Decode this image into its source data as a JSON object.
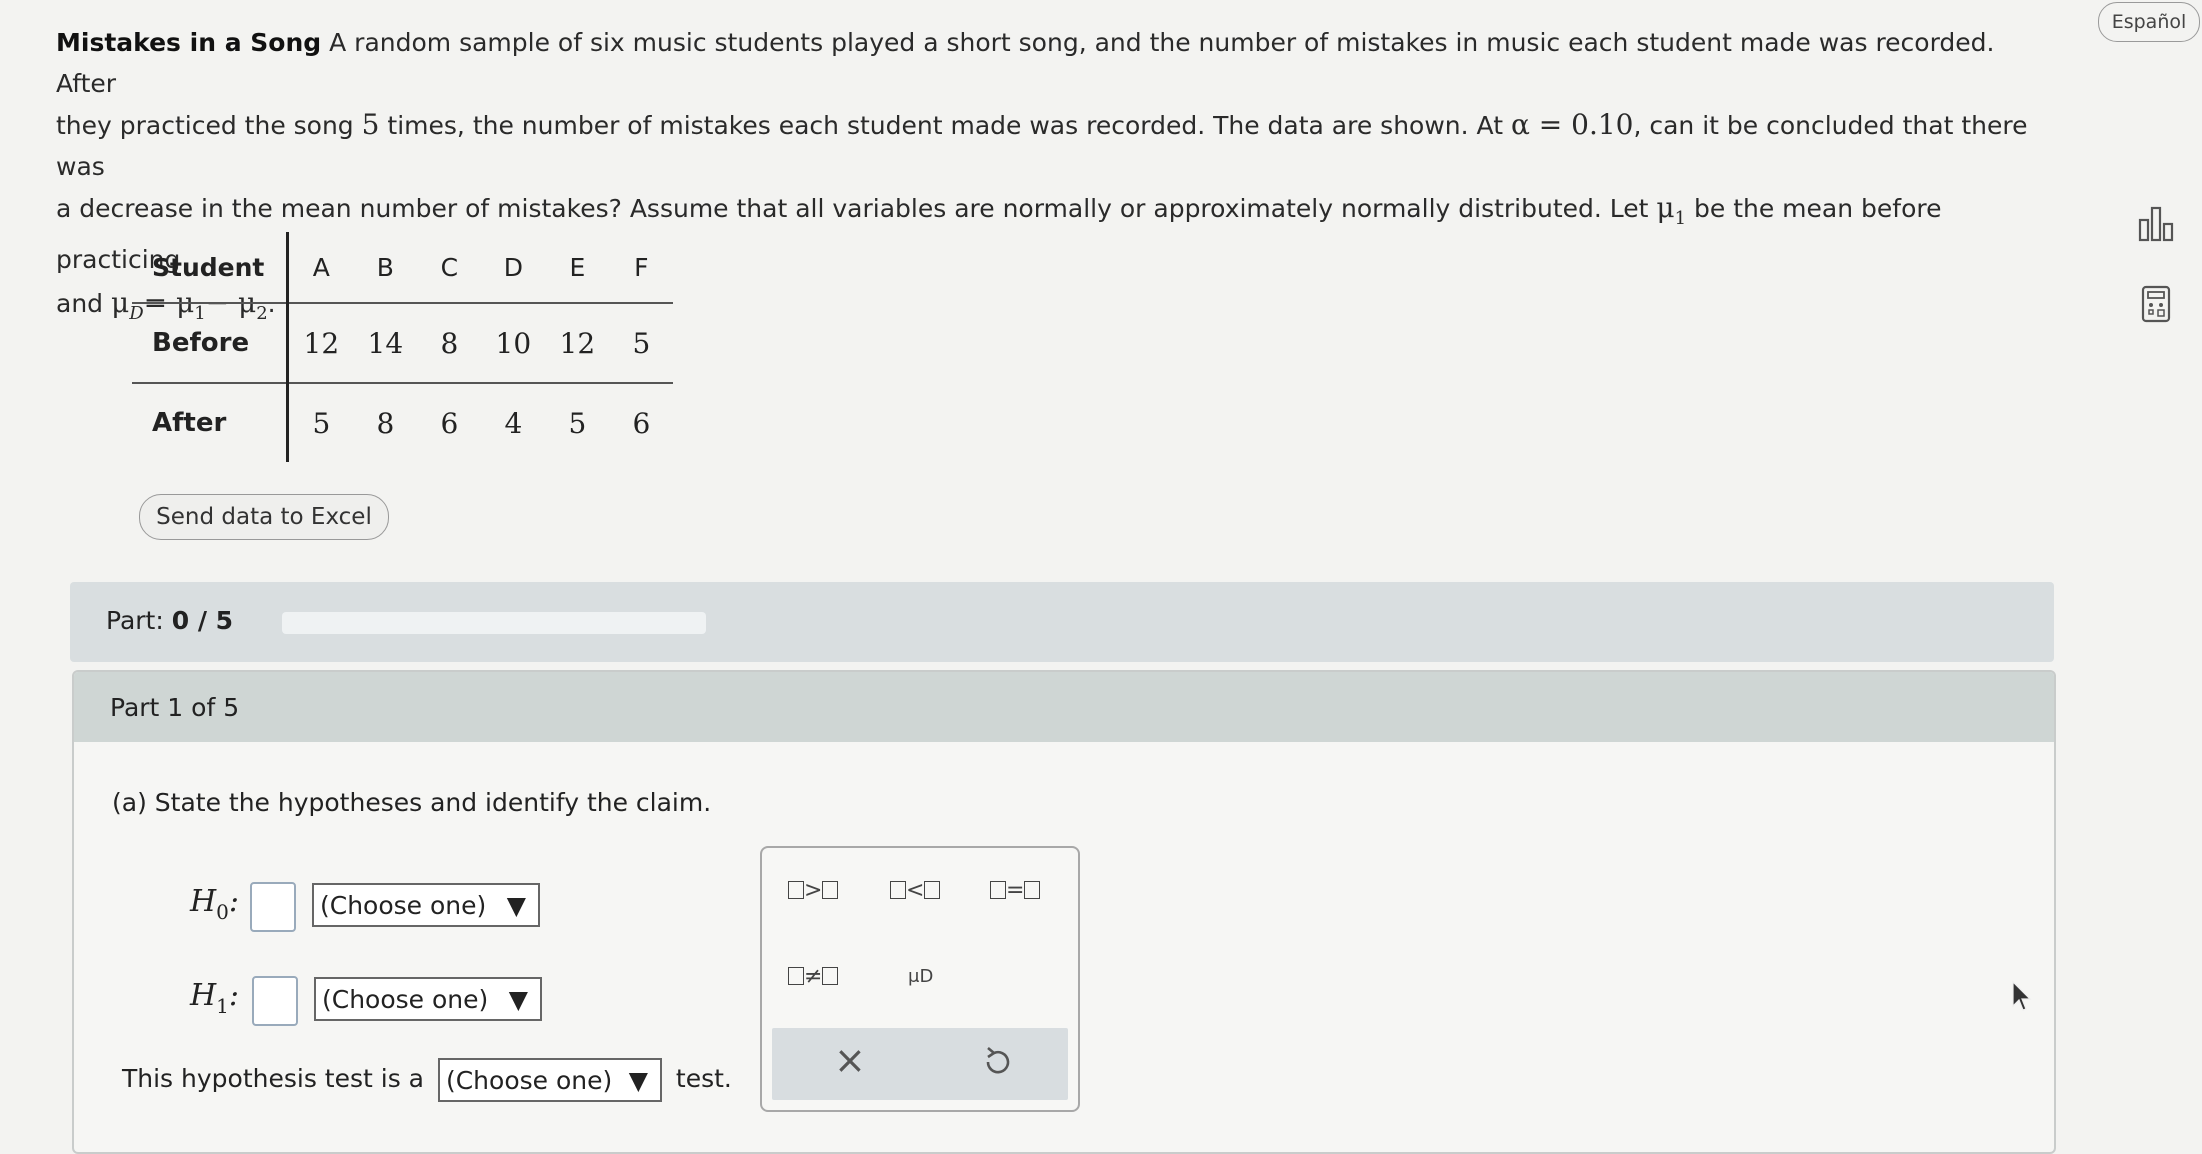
{
  "language_button": "Español",
  "problem": {
    "title": "Mistakes in a Song",
    "line1": " A random sample of six music students played a short song, and the number of mistakes in music each student made was recorded. After",
    "line2a": "they practiced the song ",
    "times": "5",
    "line2b": " times, the number of mistakes each student made was recorded. The data are shown. At ",
    "alpha": "α = 0.10",
    "line2c": ", can it be concluded that there was",
    "line3a": "a decrease in the mean number of mistakes? Assume that all variables are normally or approximately normally distributed. Let ",
    "mu1": "μ",
    "line3b": " be the mean before practicing",
    "line4a": "and ",
    "mud": "μ",
    "line4b": "= μ",
    "line4c": "− μ",
    "line4d": "."
  },
  "table": {
    "row_labels": [
      "Student",
      "Before",
      "After"
    ],
    "students": [
      "A",
      "B",
      "C",
      "D",
      "E",
      "F"
    ],
    "before": [
      "12",
      "14",
      "8",
      "10",
      "12",
      "5"
    ],
    "after": [
      "5",
      "8",
      "6",
      "4",
      "5",
      "6"
    ]
  },
  "excel_button": "Send data to Excel",
  "part_bar": {
    "label": "Part:",
    "progress_text": "0 / 5",
    "progress_fraction": 0
  },
  "panel": {
    "header": "Part 1 of 5",
    "question": "(a) State the hypotheses and identify the claim.",
    "h0_letter": "H",
    "h0_sub": "0",
    "h1_letter": "H",
    "h1_sub": "1",
    "choose": "(Choose one)",
    "test_prefix": "This hypothesis test is a",
    "test_suffix": "test."
  },
  "palette": {
    "gt": ">",
    "lt": "<",
    "eq": "=",
    "ne": "≠",
    "mu_d": "μD",
    "clear": "×"
  }
}
